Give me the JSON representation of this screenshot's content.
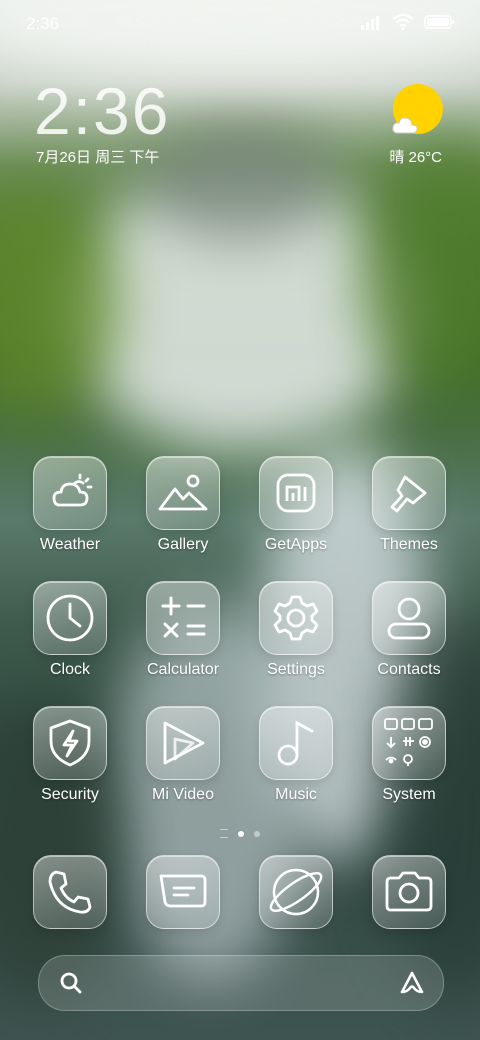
{
  "status_bar": {
    "time": "2:36"
  },
  "widget": {
    "clock": "2:36",
    "date": "7月26日 周三 下午",
    "weather": "晴 26°C"
  },
  "apps": [
    {
      "label": "Weather",
      "icon": "weather-icon"
    },
    {
      "label": "Gallery",
      "icon": "gallery-icon"
    },
    {
      "label": "GetApps",
      "icon": "getapps-icon"
    },
    {
      "label": "Themes",
      "icon": "themes-brush-icon"
    },
    {
      "label": "Clock",
      "icon": "clock-icon"
    },
    {
      "label": "Calculator",
      "icon": "calculator-icon"
    },
    {
      "label": "Settings",
      "icon": "gear-icon"
    },
    {
      "label": "Contacts",
      "icon": "person-icon"
    },
    {
      "label": "Security",
      "icon": "shield-bolt-icon"
    },
    {
      "label": "Mi Video",
      "icon": "play-icon"
    },
    {
      "label": "Music",
      "icon": "music-note-icon"
    },
    {
      "label": "System",
      "icon": "folder-grid-icon"
    }
  ],
  "dock": [
    {
      "name": "phone",
      "icon": "phone-icon"
    },
    {
      "name": "messages",
      "icon": "message-icon"
    },
    {
      "name": "browser",
      "icon": "planet-icon"
    },
    {
      "name": "camera",
      "icon": "camera-icon"
    }
  ],
  "colors": {
    "sun": "#ffd200",
    "accent": "#ffffff"
  }
}
